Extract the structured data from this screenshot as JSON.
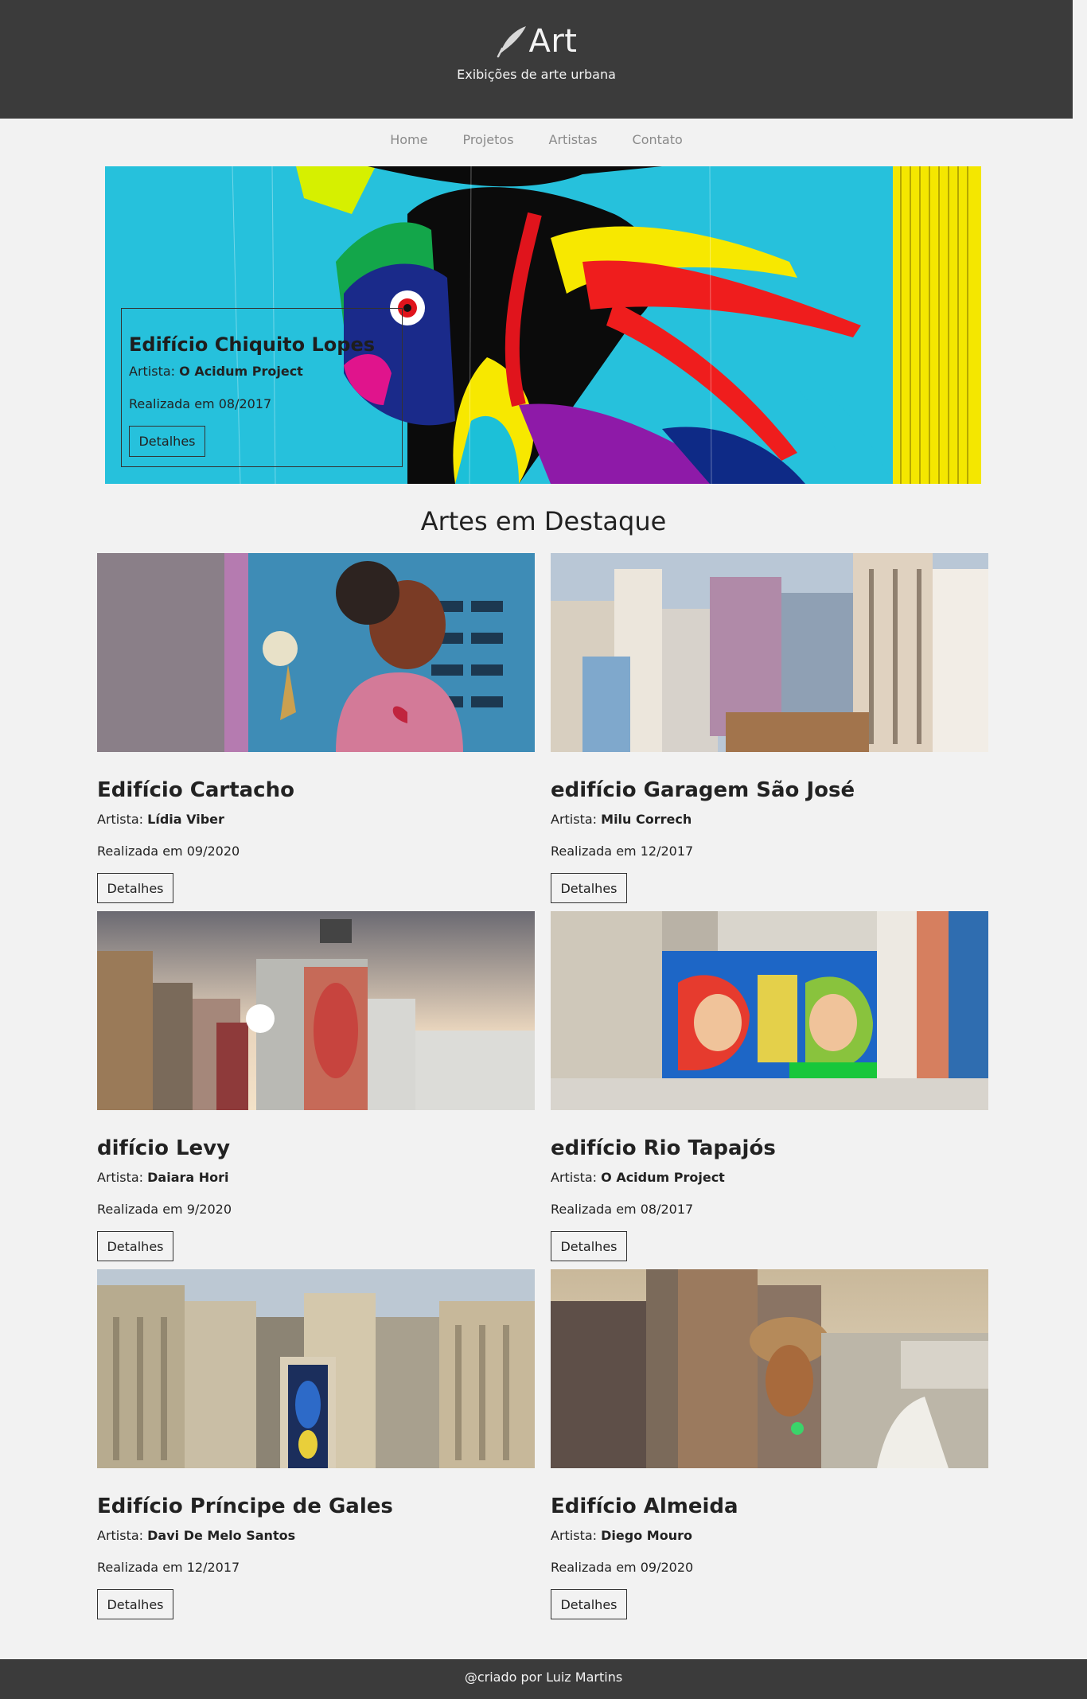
{
  "header": {
    "title": "Art",
    "tagline": "Exibições de arte urbana"
  },
  "nav": {
    "items": [
      "Home",
      "Projetos",
      "Artistas",
      "Contato"
    ]
  },
  "hero": {
    "title": "Edifício Chiquito Lopes",
    "artist_label": "Artista:",
    "artist": "O Acidum Project",
    "date": "Realizada em 08/2017",
    "button": "Detalhes"
  },
  "featured": {
    "title": "Artes em Destaque",
    "cards": [
      {
        "title": "Edifício Cartacho",
        "artist_label": "Artista:",
        "artist": "Lídia Viber",
        "date": "Realizada em 09/2020",
        "button": "Detalhes"
      },
      {
        "title": "edifício Garagem São José",
        "artist_label": "Artista:",
        "artist": "Milu Correch",
        "date": "Realizada em 12/2017",
        "button": "Detalhes"
      },
      {
        "title": "difício Levy",
        "artist_label": "Artista:",
        "artist": "Daiara Hori",
        "date": "Realizada em 9/2020",
        "button": "Detalhes"
      },
      {
        "title": "edifício Rio Tapajós",
        "artist_label": "Artista:",
        "artist": "O Acidum Project",
        "date": "Realizada em 08/2017",
        "button": "Detalhes"
      },
      {
        "title": "Edifício Príncipe de Gales",
        "artist_label": "Artista:",
        "artist": "Davi De Melo Santos",
        "date": "Realizada em 12/2017",
        "button": "Detalhes"
      },
      {
        "title": "Edifício Almeida",
        "artist_label": "Artista:",
        "artist": "Diego Mouro",
        "date": "Realizada em 09/2020",
        "button": "Detalhes"
      }
    ]
  },
  "footer": {
    "credit": "@criado por Luiz Martins"
  },
  "icons": {
    "brand": "quill-pen-icon"
  },
  "colors": {
    "header_bg": "#3b3b3b",
    "page_bg": "#f2f2f2",
    "nav_text": "#8a8a8a"
  }
}
